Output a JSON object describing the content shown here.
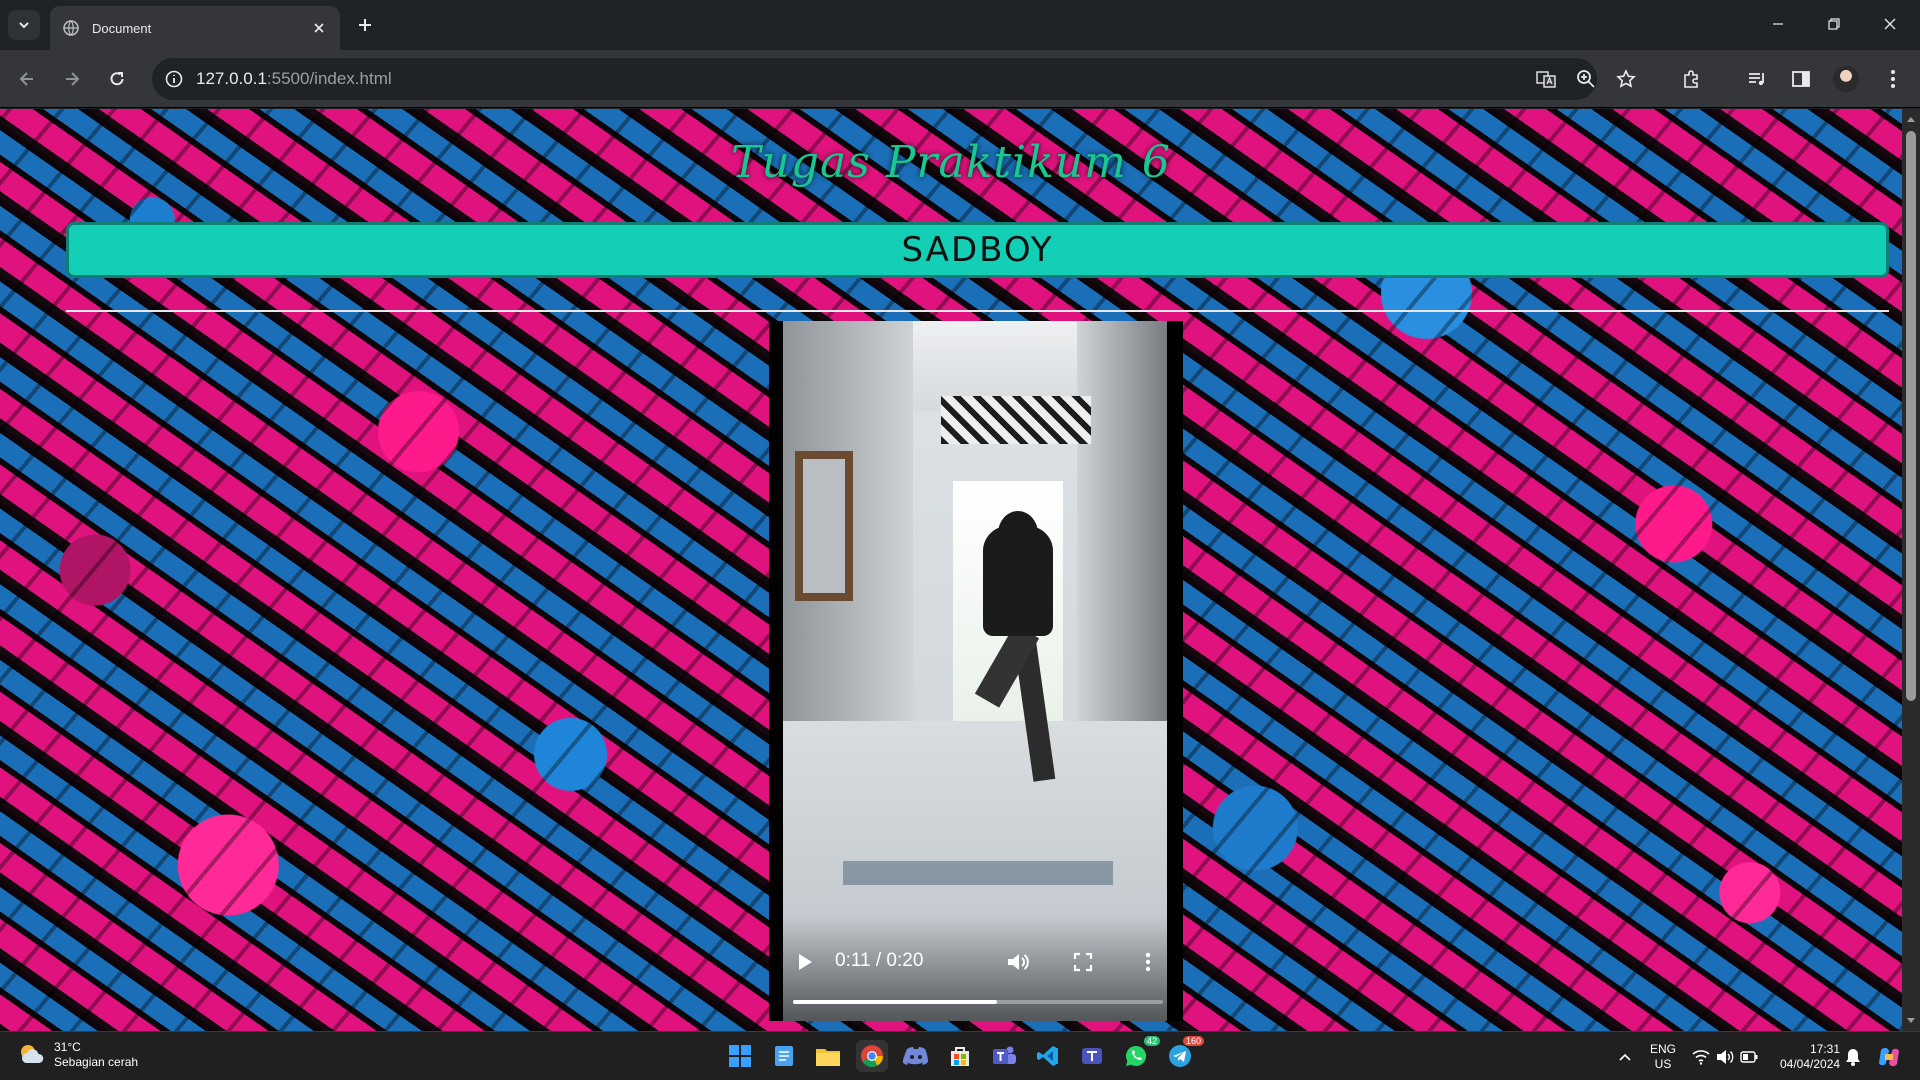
{
  "browser": {
    "tab_title": "Document",
    "url_host": "127.0.0.1",
    "url_rest": ":5500/index.html"
  },
  "page": {
    "heading": "Tugas Praktikum 6",
    "banner": "SADBOY"
  },
  "video": {
    "time": "0:11 / 0:20",
    "progress_fraction": 0.55
  },
  "taskbar": {
    "temp": "31°C",
    "condition": "Sebagian cerah",
    "whatsapp_badge": "42",
    "telegram_badge": "160",
    "lang": "ENG",
    "region": "US",
    "time": "17:31",
    "date": "04/04/2024"
  }
}
